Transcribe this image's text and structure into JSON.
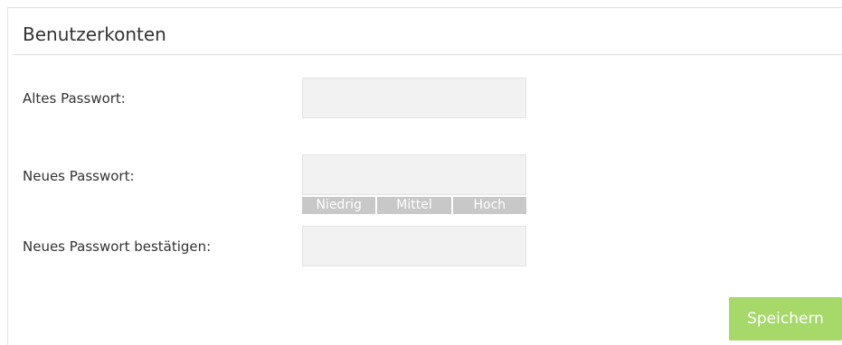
{
  "panel": {
    "title": "Benutzerkonten"
  },
  "form": {
    "old_password": {
      "label": "Altes Passwort:",
      "value": ""
    },
    "new_password": {
      "label": "Neues Passwort:",
      "value": ""
    },
    "confirm_password": {
      "label": "Neues Passwort bestätigen:",
      "value": ""
    },
    "strength": {
      "low": "Niedrig",
      "medium": "Mittel",
      "high": "Hoch"
    },
    "save_label": "Speichern"
  },
  "colors": {
    "save_button": "#a6d86a",
    "strength_inactive": "#c8c8c8",
    "input_background": "#f2f2f2"
  }
}
